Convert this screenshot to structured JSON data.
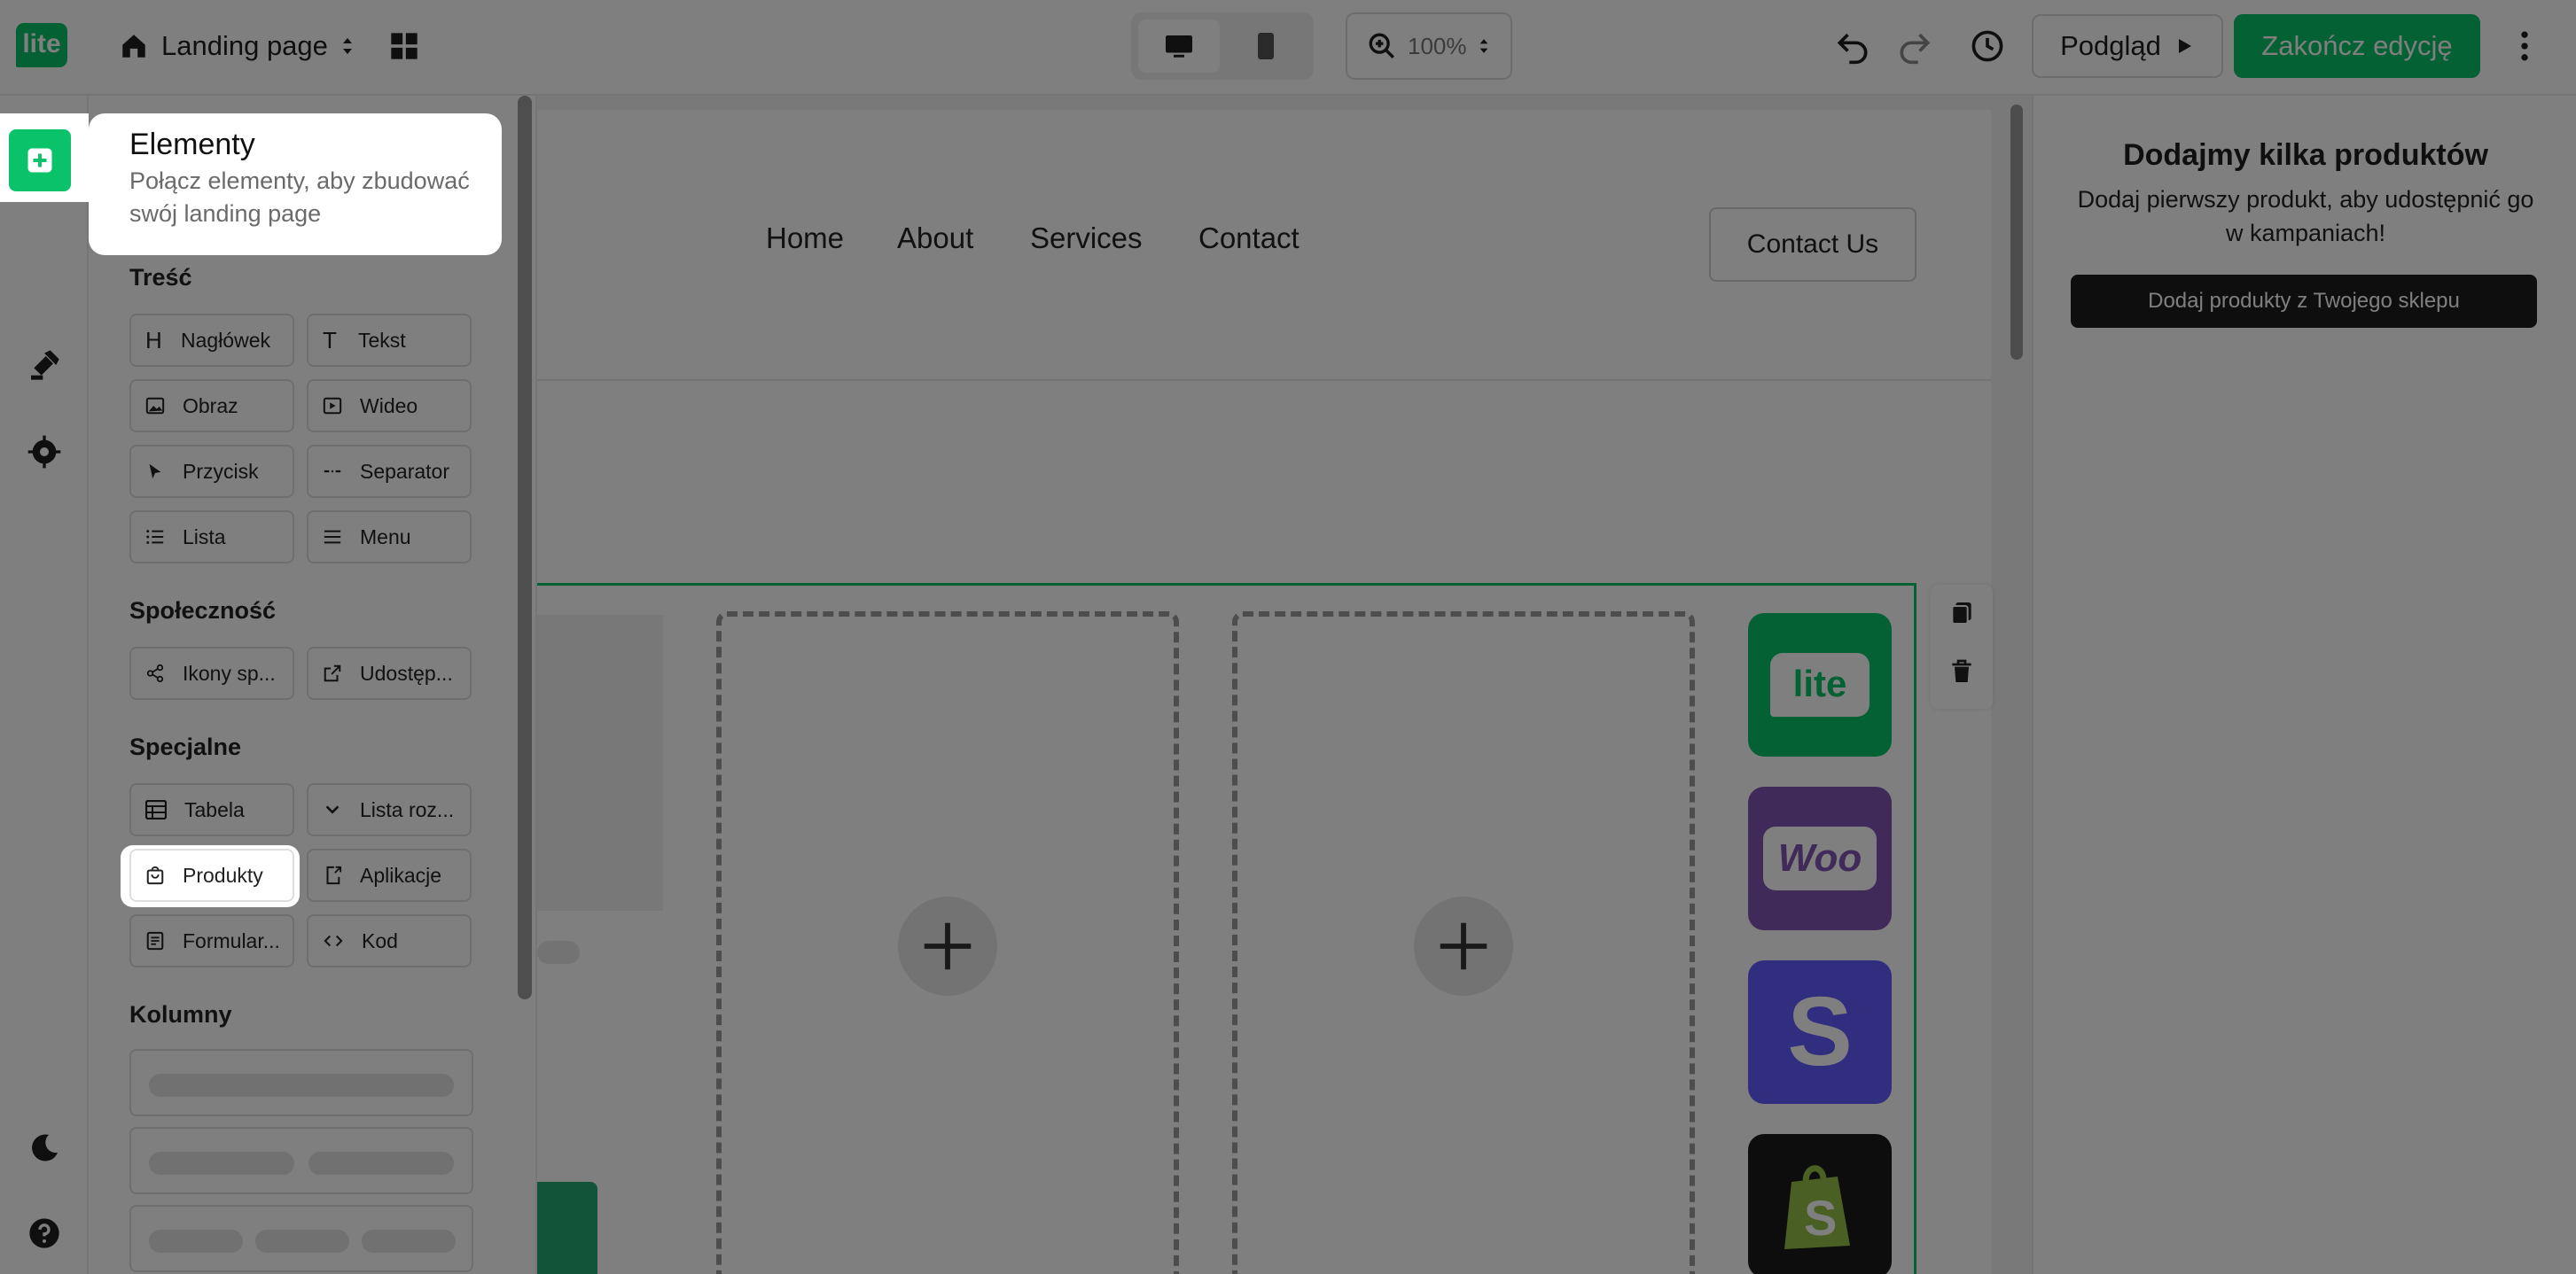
{
  "topbar": {
    "logo_text": "lite",
    "page_name": "Landing page",
    "zoom": "100%",
    "preview_label": "Podgląd",
    "finish_label": "Zakończ edycję"
  },
  "sidebar": {
    "header_title": "Elementy",
    "header_desc": "Połącz elementy, aby zbudować swój landing page",
    "sections": {
      "content": {
        "title": "Treść",
        "items": [
          "Nagłówek",
          "Tekst",
          "Obraz",
          "Wideo",
          "Przycisk",
          "Separator",
          "Lista",
          "Menu"
        ]
      },
      "social": {
        "title": "Społeczność",
        "items": [
          "Ikony sp...",
          "Udostęp..."
        ]
      },
      "special": {
        "title": "Specjalne",
        "items": [
          "Tabela",
          "Lista roz...",
          "Produkty",
          "Aplikacje",
          "Formular...",
          "Kod"
        ]
      },
      "columns": {
        "title": "Kolumny"
      }
    }
  },
  "canvas": {
    "nav": [
      "Home",
      "About",
      "Services",
      "Contact"
    ],
    "contact_button": "Contact Us",
    "app_tiles": [
      "lite",
      "Woo",
      "S"
    ]
  },
  "right_panel": {
    "title": "Dodajmy kilka produktów",
    "desc": "Dodaj pierwszy produkt, aby udostępnić go w kampaniach!",
    "button": "Dodaj produkty z Twojego sklepu"
  },
  "colors": {
    "brand_green": "#09c269",
    "woo_purple": "#7f54b3",
    "stripe_indigo": "#635bff",
    "shopify_dark": "#1b1b1b",
    "shopify_green": "#95bf47"
  },
  "icons": [
    "home-icon",
    "grid-icon",
    "desktop-icon",
    "mobile-icon",
    "zoom-in-icon",
    "undo-icon",
    "redo-icon",
    "history-icon",
    "play-icon",
    "more-icon",
    "add-element-icon",
    "layout-icon",
    "paint-icon",
    "settings-icon",
    "moon-icon",
    "help-icon"
  ]
}
